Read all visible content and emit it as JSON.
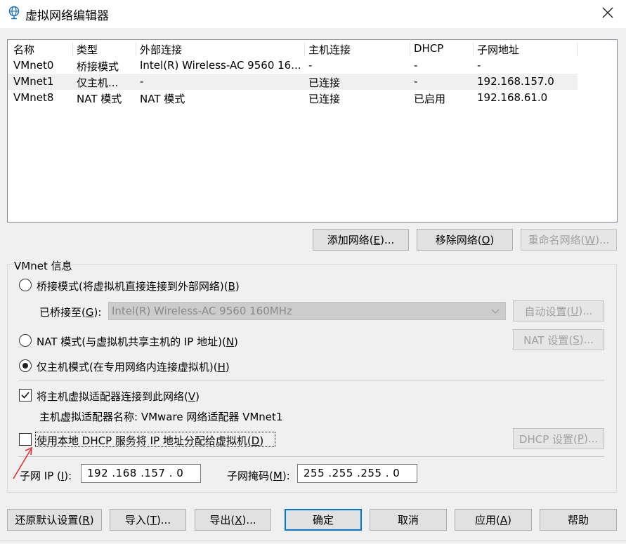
{
  "window": {
    "title": "虚拟网络编辑器"
  },
  "table": {
    "headers": [
      "名称",
      "类型",
      "外部连接",
      "主机连接",
      "DHCP",
      "子网地址"
    ],
    "rows": [
      [
        "VMnet0",
        "桥接模式",
        "Intel(R) Wireless-AC 9560 16...",
        "-",
        "-",
        "-"
      ],
      [
        "VMnet1",
        "仅主机...",
        "-",
        "已连接",
        "-",
        "192.168.157.0"
      ],
      [
        "VMnet8",
        "NAT 模式",
        "NAT 模式",
        "已连接",
        "已启用",
        "192.168.61.0"
      ]
    ],
    "selected_row": 1
  },
  "network_buttons": {
    "add": {
      "pre": "添加网络(",
      "key": "E",
      "post": ")..."
    },
    "remove": {
      "pre": "移除网络(",
      "key": "O",
      "post": ")"
    },
    "rename": {
      "pre": "重命名网络(",
      "key": "W",
      "post": ")..."
    }
  },
  "vmnet_info": {
    "group_label": "VMnet 信息",
    "bridged": {
      "pre": "桥接模式(将虚拟机直接连接到外部网络)(",
      "key": "B",
      "post": ")",
      "checked": false
    },
    "bridged_to": {
      "pre": "已桥接至(",
      "key": "G",
      "post": "):",
      "value": "Intel(R) Wireless-AC 9560 160MHz"
    },
    "auto_settings": {
      "pre": "自动设置(",
      "key": "U",
      "post": ")..."
    },
    "nat": {
      "pre": "NAT 模式(与虚拟机共享主机的 IP 地址)(",
      "key": "N",
      "post": ")",
      "checked": false
    },
    "nat_settings": {
      "pre": "NAT 设置(",
      "key": "S",
      "post": ")..."
    },
    "host_only": {
      "pre": "仅主机模式(在专用网络内连接虚拟机)(",
      "key": "H",
      "post": ")",
      "checked": true
    },
    "connect_adapter": {
      "pre": "将主机虚拟适配器连接到此网络(",
      "key": "V",
      "post": ")",
      "checked": true
    },
    "adapter_name": "主机虚拟适配器名称: VMware 网络适配器 VMnet1",
    "use_dhcp": {
      "pre": "使用本地 DHCP 服务将 IP 地址分配给虚拟机(",
      "key": "D",
      "post": ")",
      "checked": false
    },
    "dhcp_settings": {
      "pre": "DHCP 设置(",
      "key": "P",
      "post": ")..."
    },
    "subnet_ip": {
      "pre": "子网 IP (",
      "key": "I",
      "post": "):",
      "value": "192 .168 .157 .  0"
    },
    "subnet_mask": {
      "pre": "子网掩码(",
      "key": "M",
      "post": "):",
      "value": "255 .255 .255 .  0"
    }
  },
  "bottom_buttons": {
    "restore": {
      "pre": "还原默认设置(",
      "key": "R",
      "post": ")"
    },
    "import": {
      "pre": "导入(",
      "key": "T",
      "post": ")..."
    },
    "export": {
      "pre": "导出(",
      "key": "X",
      "post": ")..."
    },
    "ok": {
      "pre": "确定",
      "key": "",
      "post": ""
    },
    "cancel": {
      "pre": "取消",
      "key": "",
      "post": ""
    },
    "apply": {
      "pre": "应用(",
      "key": "A",
      "post": ")"
    },
    "help": {
      "pre": "帮助",
      "key": "",
      "post": ""
    }
  },
  "colors": {
    "focus_border": "#0078d7",
    "annotation_arrow": "#e03030"
  }
}
